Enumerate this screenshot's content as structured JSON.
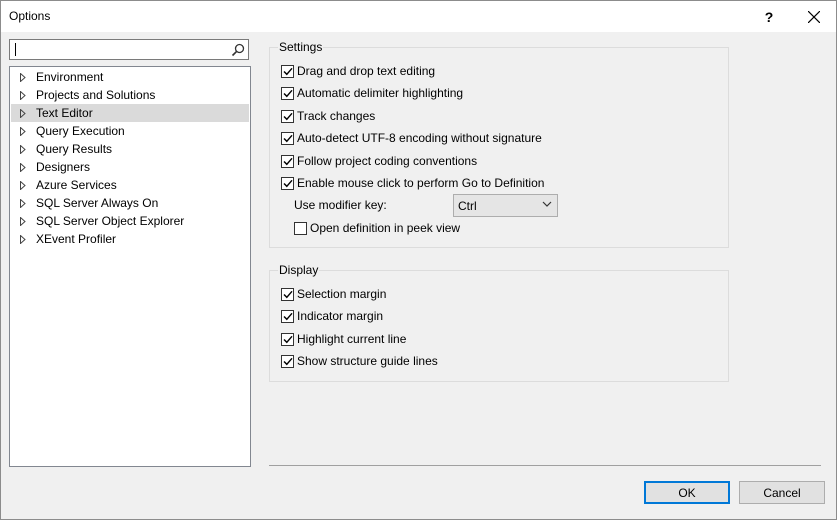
{
  "window": {
    "title": "Options",
    "help": "?",
    "close": "✕"
  },
  "search": {
    "value": "",
    "icon": "search-icon"
  },
  "tree": {
    "items": [
      {
        "label": "Environment",
        "selected": false
      },
      {
        "label": "Projects and Solutions",
        "selected": false
      },
      {
        "label": "Text Editor",
        "selected": true
      },
      {
        "label": "Query Execution",
        "selected": false
      },
      {
        "label": "Query Results",
        "selected": false
      },
      {
        "label": "Designers",
        "selected": false
      },
      {
        "label": "Azure Services",
        "selected": false
      },
      {
        "label": "SQL Server Always On",
        "selected": false
      },
      {
        "label": "SQL Server Object Explorer",
        "selected": false
      },
      {
        "label": "XEvent Profiler",
        "selected": false
      }
    ]
  },
  "settings": {
    "title": "Settings",
    "options": [
      {
        "label": "Drag and drop text editing",
        "checked": true
      },
      {
        "label": "Automatic delimiter highlighting",
        "checked": true
      },
      {
        "label": "Track changes",
        "checked": true
      },
      {
        "label": "Auto-detect UTF-8 encoding without signature",
        "checked": true
      },
      {
        "label": "Follow project coding conventions",
        "checked": true
      },
      {
        "label": "Enable mouse click to perform Go to Definition",
        "checked": true
      }
    ],
    "modifier_label": "Use modifier key:",
    "modifier_value": "Ctrl",
    "peek": {
      "label": "Open definition in peek view",
      "checked": false
    }
  },
  "display": {
    "title": "Display",
    "options": [
      {
        "label": "Selection margin",
        "checked": true
      },
      {
        "label": "Indicator margin",
        "checked": true
      },
      {
        "label": "Highlight current line",
        "checked": true
      },
      {
        "label": "Show structure guide lines",
        "checked": true
      }
    ]
  },
  "buttons": {
    "ok": "OK",
    "cancel": "Cancel"
  }
}
